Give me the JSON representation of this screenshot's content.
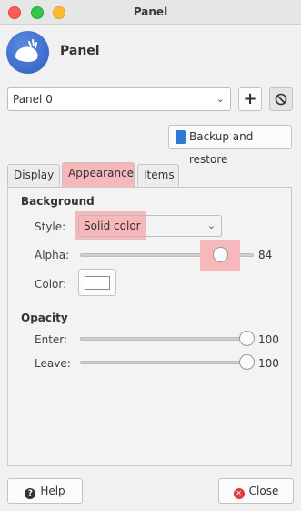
{
  "window": {
    "title": "Panel"
  },
  "header": {
    "title": "Panel",
    "logo": "xfce-mouse-icon"
  },
  "panel_select": {
    "value": "Panel 0"
  },
  "toolbar": {
    "add_icon": "+",
    "remove_icon": "⊘"
  },
  "backup": {
    "label": "Backup and restore"
  },
  "tabs": [
    {
      "label": "Display",
      "active": false
    },
    {
      "label": "Appearance",
      "active": true
    },
    {
      "label": "Items",
      "active": false
    }
  ],
  "background": {
    "section_title": "Background",
    "style_label": "Style:",
    "style_value": "Solid color",
    "alpha_label": "Alpha:",
    "alpha_value": "84",
    "color_label": "Color:",
    "color_value": "#ffffff"
  },
  "opacity": {
    "section_title": "Opacity",
    "enter_label": "Enter:",
    "enter_value": "100",
    "leave_label": "Leave:",
    "leave_value": "100"
  },
  "footer": {
    "help_label": "Help",
    "close_label": "Close"
  },
  "colors": {
    "highlight": "#f6b8bb",
    "accent": "#2f78d6"
  }
}
